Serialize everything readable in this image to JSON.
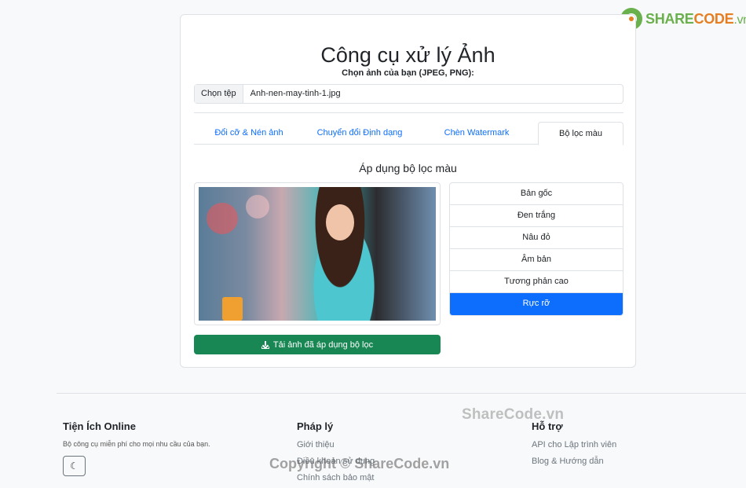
{
  "logo": {
    "part1": "SHARE",
    "part2": "CODE",
    "part3": ".vn"
  },
  "page": {
    "title": "Công cụ xử lý Ảnh"
  },
  "upload": {
    "label": "Chọn ảnh của bạn (JPEG, PNG):",
    "button": "Chọn tệp",
    "file_name": "Anh-nen-may-tinh-1.jpg"
  },
  "tabs": [
    {
      "label": "Đổi cỡ & Nén ảnh"
    },
    {
      "label": "Chuyển đổi Định dạng"
    },
    {
      "label": "Chèn Watermark"
    },
    {
      "label": "Bộ lọc màu"
    }
  ],
  "filter_section": {
    "title": "Áp dụng bộ lọc màu",
    "filters": [
      {
        "label": "Bản gốc"
      },
      {
        "label": "Đen trắng"
      },
      {
        "label": "Nâu đỏ"
      },
      {
        "label": "Âm bản"
      },
      {
        "label": "Tương phản cao"
      },
      {
        "label": "Rực rỡ"
      }
    ],
    "active_filter": "Rực rỡ",
    "download_label": "Tải ảnh đã áp dụng bộ lọc"
  },
  "footer": {
    "col1": {
      "heading": "Tiện Ích Online",
      "desc": "Bộ công cụ miễn phí cho mọi nhu cầu của bạn."
    },
    "col2": {
      "heading": "Pháp lý",
      "links": [
        "Giới thiệu",
        "Điều khoản sử dụng",
        "Chính sách bảo mật"
      ]
    },
    "col3": {
      "heading": "Hỗ trợ",
      "links": [
        "API cho Lập trình viên",
        "Blog & Hướng dẫn"
      ]
    }
  },
  "watermarks": {
    "top": "ShareCode.vn",
    "bottom": "Copyright © ShareCode.vn"
  },
  "colors": {
    "primary": "#0d6efd",
    "success": "#198754",
    "border": "#dee2e6"
  }
}
